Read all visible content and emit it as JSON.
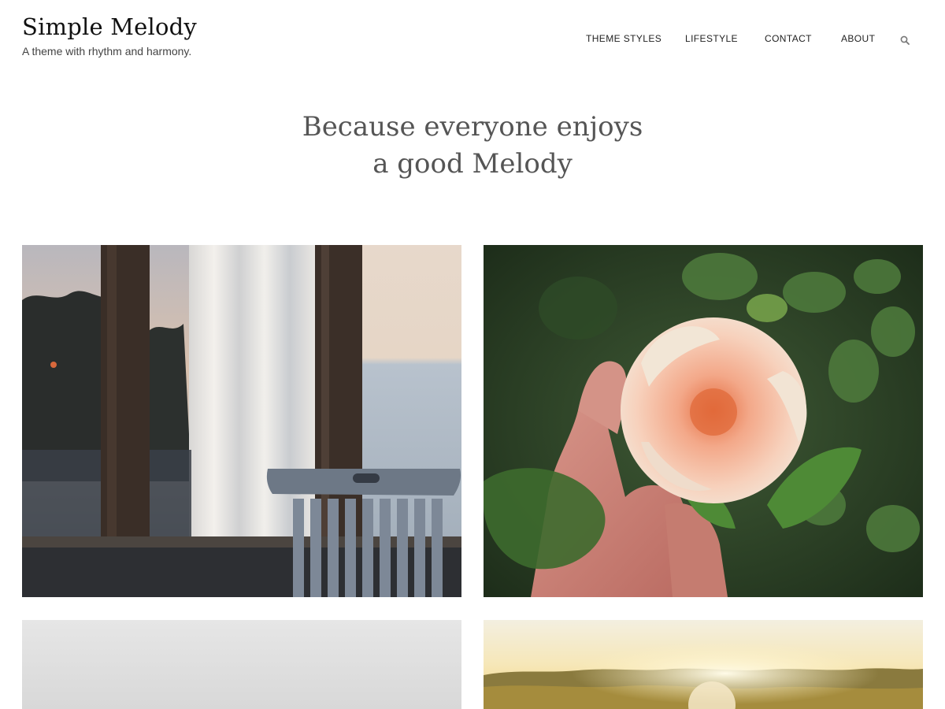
{
  "site": {
    "title": "Simple Melody",
    "tagline": "A theme with rhythm and harmony."
  },
  "nav": {
    "items": [
      {
        "label": "THEME STYLES"
      },
      {
        "label": "LIFESTYLE"
      },
      {
        "label": "CONTACT"
      },
      {
        "label": "ABOUT"
      }
    ],
    "search_icon": "search-icon"
  },
  "hero": {
    "line1": "Because everyone enjoys",
    "line2": "a good Melody"
  },
  "posts": [
    {
      "image": "window-with-wooden-chair-photo"
    },
    {
      "image": "hand-holding-peach-rose-photo"
    },
    {
      "image": "pale-grey-sky-photo"
    },
    {
      "image": "golden-sunset-field-photo"
    }
  ],
  "colors": {
    "text": "#222222",
    "hero_text": "#555555",
    "background": "#ffffff"
  }
}
